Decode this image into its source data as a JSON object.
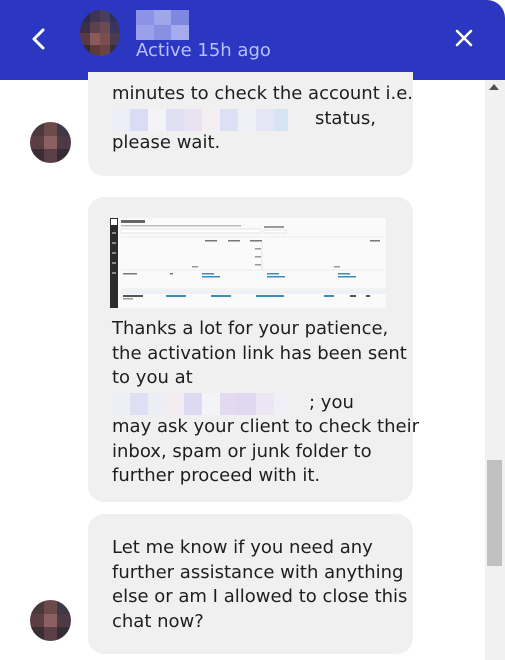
{
  "header": {
    "status": "Active 15h ago",
    "background": "#2b36c1"
  },
  "messages": [
    {
      "line1": "minutes to check the account i.e.",
      "status_word": "status,",
      "line3": "please wait."
    },
    {
      "attachment": "screenshot",
      "line1": "Thanks a lot for your patience,",
      "line2": "the activation link has been sent",
      "line3": "to you at",
      "after_email": "; you",
      "line5": "may ask your client to check their",
      "line6": "inbox, spam or junk folder to",
      "line7": "further proceed with it."
    },
    {
      "line1": "Let me know if you need any",
      "line2": "further assistance with anything",
      "line3": "else or am I allowed to close this",
      "line4": "chat now?"
    }
  ],
  "icons": {
    "back": "chevron-left-icon",
    "close": "close-icon"
  },
  "colors": {
    "bubble": "#f0f0f0",
    "status_text": "#b9c0ff"
  }
}
